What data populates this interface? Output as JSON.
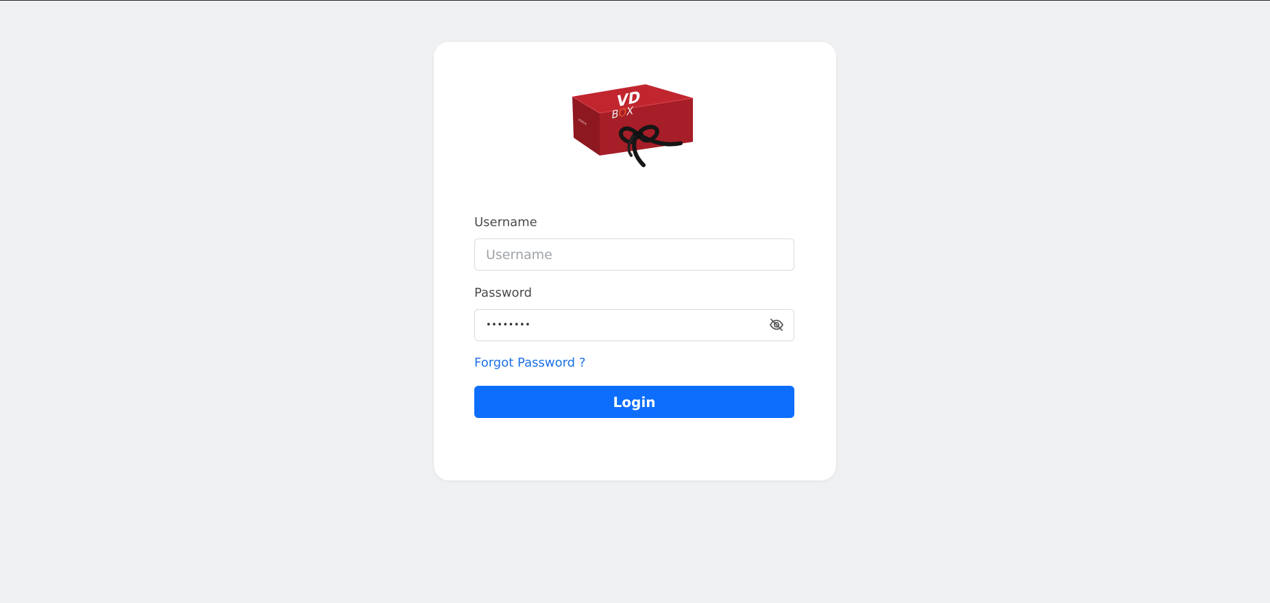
{
  "logo": {
    "alt": "VD BOX",
    "brand_top": "VD",
    "brand_bottom": "BOX",
    "box_color": "#b8232c",
    "ribbon_color": "#161616"
  },
  "form": {
    "username_label": "Username",
    "username_placeholder": "Username",
    "username_value": "",
    "password_label": "Password",
    "password_masked": "••••••••",
    "password_toggle_icon": "eye-slash-icon",
    "forgot_link": "Forgot Password ?",
    "login_label": "Login"
  },
  "colors": {
    "page_bg": "#eff0f2",
    "card_bg": "#ffffff",
    "primary": "#0d6efd",
    "link": "#1a6fe6"
  }
}
